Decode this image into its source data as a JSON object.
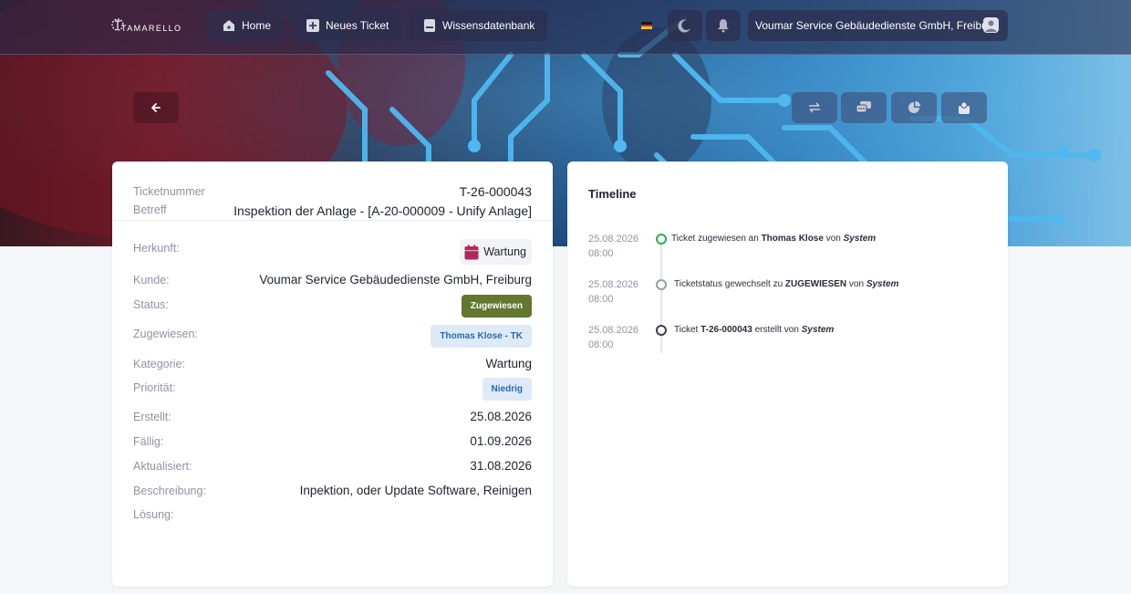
{
  "app": {
    "logo_text": "TAMARELLO"
  },
  "nav": {
    "home": "Home",
    "new_ticket": "Neues Ticket",
    "knowledge_base": "Wissensdatenbank",
    "language_flag": "de-flag-icon",
    "user": "Voumar Service Gebäudedienste GmbH, Freiburg"
  },
  "ticket": {
    "number_label": "Ticketnummer",
    "number": "T-26-000043",
    "subject_label": "Betreff",
    "subject": "Inspektion der Anlage - [A-20-000009 - Unify Anlage]",
    "fields": {
      "origin_label": "Herkunft:",
      "origin": "Wartung",
      "customer_label": "Kunde:",
      "customer": "Voumar Service Gebäudedienste GmbH, Freiburg",
      "status_label": "Status:",
      "status": "Zugewiesen",
      "assigned_label": "Zugewiesen:",
      "assigned": "Thomas Klose - TK",
      "category_label": "Kategorie:",
      "category": "Wartung",
      "priority_label": "Priorität:",
      "priority": "Niedrig",
      "created_label": "Erstellt:",
      "created": "25.08.2026",
      "due_label": "Fällig:",
      "due": "01.09.2026",
      "updated_label": "Aktualisiert:",
      "updated": "31.08.2026",
      "description_label": "Beschreibung:",
      "description": "Inpektion, oder Update Software, Reinigen",
      "solution_label": "Lösung:",
      "solution": ""
    }
  },
  "timeline": {
    "title": "Timeline",
    "entries": [
      {
        "date": "25.08.2026",
        "time": "08:00",
        "pre": "Ticket zugewiesen an ",
        "strong": "Thomas Klose",
        "mid": " von ",
        "actor": "System",
        "dot_color": "#28b04a"
      },
      {
        "date": "25.08.2026",
        "time": "08:00",
        "pre": "Ticketstatus gewechselt zu ",
        "strong": "ZUGEWIESEN",
        "mid": " von ",
        "actor": "System",
        "dot_color": "#9a9da8"
      },
      {
        "date": "25.08.2026",
        "time": "08:00",
        "pre": "Ticket ",
        "strong": "T-26-000043",
        "mid": " erstellt von ",
        "actor": "System",
        "dot_color": "#3a3f52"
      }
    ]
  },
  "colors": {
    "status_badge": "#63772f",
    "chip_blue_bg": "#deeaf8",
    "chip_blue_text": "#2a69b0",
    "calendar_icon": "#b0285a"
  }
}
